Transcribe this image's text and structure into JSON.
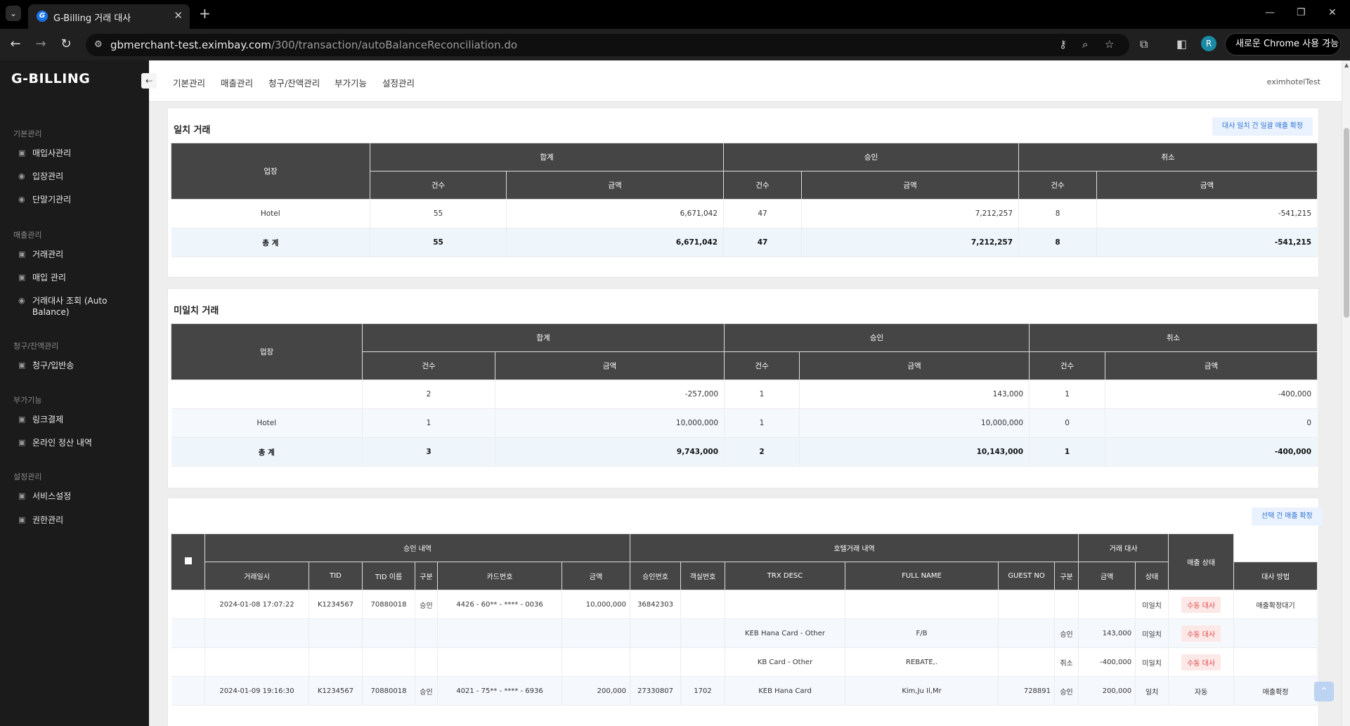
{
  "browser": {
    "tab_title": "G-Billing 거래 대사",
    "tab_icon": "G",
    "url_domain": "gbmerchant-test.eximbay.com",
    "url_path": "/300/transaction/autoBalanceReconciliation.do",
    "profile_initial": "R",
    "chrome_pill": "새로운 Chrome 사용 가능"
  },
  "sidebar": {
    "logo": "G-BILLING",
    "groups": [
      {
        "title": "기본관리",
        "items": [
          {
            "label": "매입사관리",
            "icon": "document-icon"
          },
          {
            "label": "입장관리",
            "icon": "circle-icon"
          },
          {
            "label": "단말기관리",
            "icon": "circle-icon"
          }
        ]
      },
      {
        "title": "매출관리",
        "items": [
          {
            "label": "거래관리",
            "icon": "document-icon"
          },
          {
            "label": "매입 관리",
            "icon": "document-icon"
          },
          {
            "label": "거래대사 조회 (Auto Balance)",
            "icon": "circle-icon"
          }
        ]
      },
      {
        "title": "청구/잔액관리",
        "items": [
          {
            "label": "청구/입반송",
            "icon": "document-icon"
          }
        ]
      },
      {
        "title": "부가기능",
        "items": [
          {
            "label": "링크결제",
            "icon": "document-icon"
          },
          {
            "label": "온라인 정산 내역",
            "icon": "document-icon"
          }
        ]
      },
      {
        "title": "설정관리",
        "items": [
          {
            "label": "서비스설정",
            "icon": "document-icon"
          },
          {
            "label": "권한관리",
            "icon": "document-icon"
          }
        ]
      }
    ]
  },
  "topnav": {
    "items": [
      "기본관리",
      "매출관리",
      "청구/잔액관리",
      "부가기능",
      "설정관리"
    ],
    "user": "eximhotelTest"
  },
  "matched": {
    "title": "일치 거래",
    "button": "대사 일치 건 일괄 매출 확정",
    "headers": {
      "store": "업장",
      "total": "합계",
      "approve": "승인",
      "cancel": "취소",
      "count": "건수",
      "amount": "금액"
    },
    "rows": [
      {
        "store": "Hotel",
        "t_cnt": "55",
        "t_amt": "6,671,042",
        "a_cnt": "47",
        "a_amt": "7,212,257",
        "c_cnt": "8",
        "c_amt": "-541,215"
      }
    ],
    "sum": {
      "store": "총 계",
      "t_cnt": "55",
      "t_amt": "6,671,042",
      "a_cnt": "47",
      "a_amt": "7,212,257",
      "c_cnt": "8",
      "c_amt": "-541,215"
    }
  },
  "unmatched": {
    "title": "미일치 거래",
    "headers": {
      "store": "업장",
      "total": "합계",
      "approve": "승인",
      "cancel": "취소",
      "count": "건수",
      "amount": "금액"
    },
    "rows": [
      {
        "store": "",
        "t_cnt": "2",
        "t_amt": "-257,000",
        "a_cnt": "1",
        "a_amt": "143,000",
        "c_cnt": "1",
        "c_amt": "-400,000"
      },
      {
        "store": "Hotel",
        "t_cnt": "1",
        "t_amt": "10,000,000",
        "a_cnt": "1",
        "a_amt": "10,000,000",
        "c_cnt": "0",
        "c_amt": "0"
      }
    ],
    "sum": {
      "store": "총 계",
      "t_cnt": "3",
      "t_amt": "9,743,000",
      "a_cnt": "2",
      "a_amt": "10,143,000",
      "c_cnt": "1",
      "c_amt": "-400,000"
    }
  },
  "detail": {
    "button": "선택 건 매출 확정",
    "group_headers": {
      "approval": "승인 내역",
      "hotel": "호텔거래 내역",
      "recon": "거래 대사",
      "sales_status": "매출 상태"
    },
    "columns": {
      "datetime": "거래일시",
      "tid": "TID",
      "tid_name": "TID 이름",
      "type": "구분",
      "card": "카드번호",
      "amount": "금액",
      "approval_no": "승인번호",
      "room": "객실번호",
      "trx_desc": "TRX DESC",
      "full_name": "FULL NAME",
      "guest_no": "GUEST NO",
      "h_type": "구분",
      "h_amount": "금액",
      "status": "상태",
      "method": "대사 방법"
    },
    "rows": [
      {
        "datetime": "2024-01-08 17:07:22",
        "tid": "K1234567",
        "tid_name": "70880018",
        "type": "승인",
        "card": "4426 - 60** - **** - 0036",
        "amount": "10,000,000",
        "approval_no": "36842303",
        "room": "",
        "trx_desc": "",
        "full_name": "",
        "guest_no": "",
        "h_type": "",
        "h_amount": "",
        "status": "미일치",
        "method": "수동 대사",
        "sales_status": "매출확정대기"
      },
      {
        "datetime": "",
        "tid": "",
        "tid_name": "",
        "type": "",
        "card": "",
        "amount": "",
        "approval_no": "",
        "room": "",
        "trx_desc": "KEB Hana Card - Other",
        "full_name": "F/B",
        "guest_no": "",
        "h_type": "승인",
        "h_amount": "143,000",
        "status": "미일치",
        "method": "수동 대사",
        "sales_status": ""
      },
      {
        "datetime": "",
        "tid": "",
        "tid_name": "",
        "type": "",
        "card": "",
        "amount": "",
        "approval_no": "",
        "room": "",
        "trx_desc": "KB Card - Other",
        "full_name": "REBATE,.",
        "guest_no": "",
        "h_type": "취소",
        "h_amount": "-400,000",
        "status": "미일치",
        "method": "수동 대사",
        "sales_status": ""
      },
      {
        "datetime": "2024-01-09 19:16:30",
        "tid": "K1234567",
        "tid_name": "70880018",
        "type": "승인",
        "card": "4021 - 75** - **** - 6936",
        "amount": "200,000",
        "approval_no": "27330807",
        "room": "1702",
        "trx_desc": "KEB Hana Card",
        "full_name": "Kim,Ju Il,Mr",
        "guest_no": "728891",
        "h_type": "승인",
        "h_amount": "200,000",
        "status": "일치",
        "method": "자동",
        "sales_status": "매출확정"
      }
    ]
  }
}
